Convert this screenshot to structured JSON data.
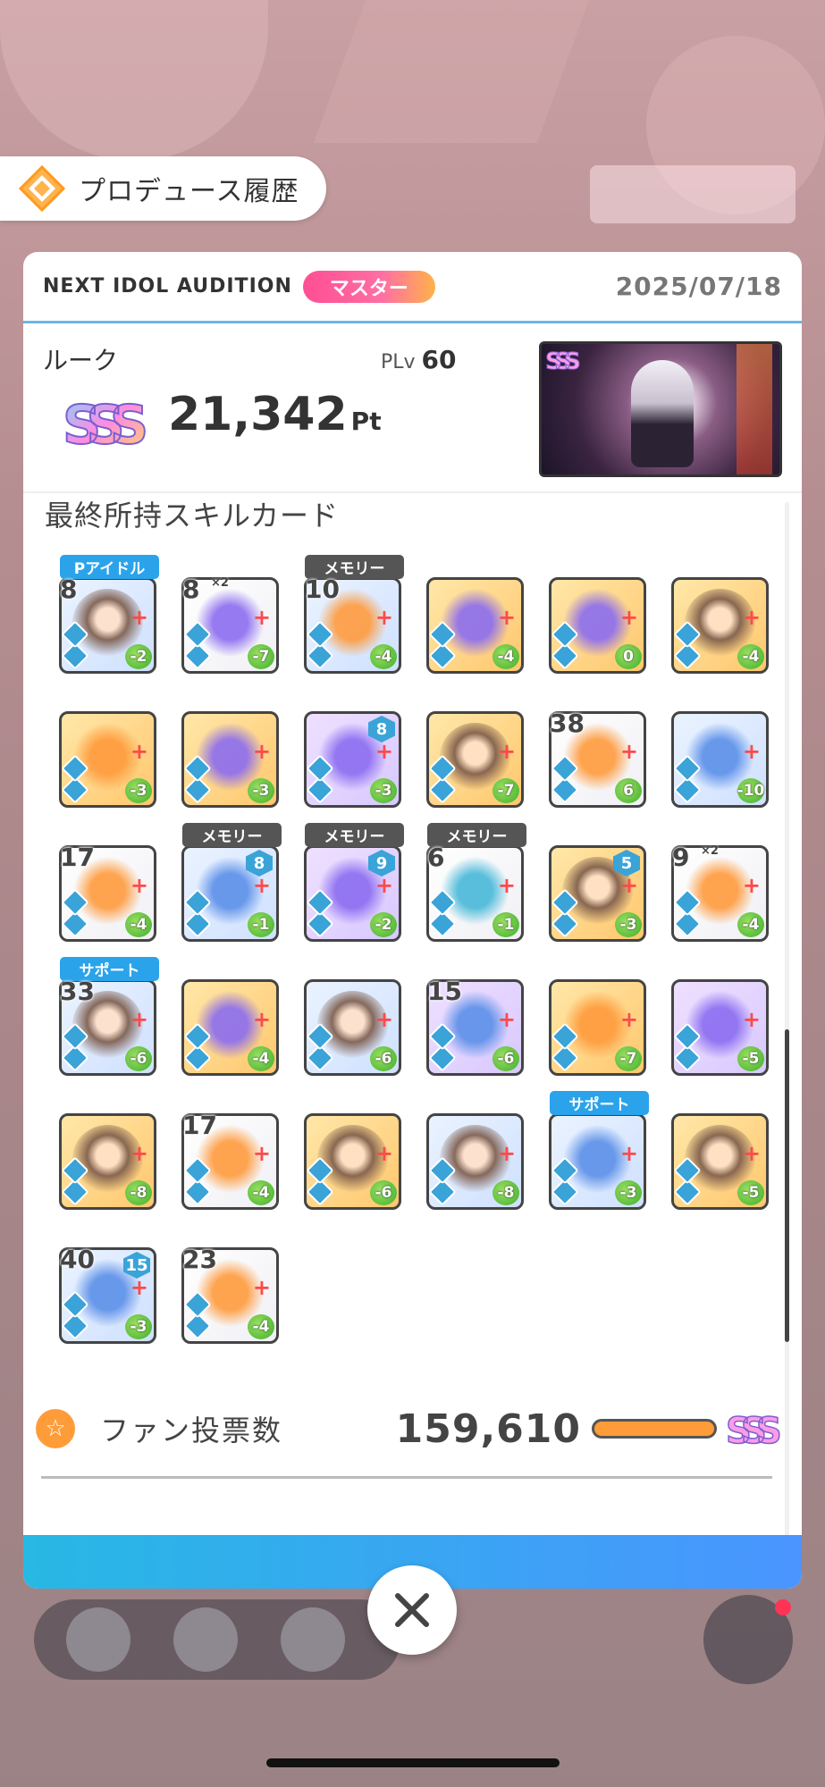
{
  "header": {
    "title": "プロデュース履歴"
  },
  "summary": {
    "audition": "NEXT IDOL AUDITION",
    "difficulty": "マスター",
    "date": "2025/07/18",
    "idol_name": "ルーク",
    "plv_label": "PLv",
    "plv_value": "60",
    "rank": "SSS",
    "score": "21,342",
    "score_unit": "Pt"
  },
  "skill_cards_title": "最終所持スキルカード",
  "cards": [
    [
      {
        "lv": "8",
        "cost": "-2",
        "tag": "Pアイドル",
        "tag_color": "blue",
        "art": "face",
        "bg": "c-blue"
      },
      {
        "lv": "8",
        "count": "×2",
        "cost": "-7",
        "art": "purple",
        "bg": "c-white"
      },
      {
        "lv": "10",
        "cost": "-4",
        "tag": "メモリー",
        "art": "orange",
        "bg": "c-blue"
      },
      {
        "lv": "",
        "cost": "-4",
        "art": "purple",
        "bg": "c-gold"
      },
      {
        "lv": "",
        "cost": "0",
        "art": "purple",
        "bg": "c-gold"
      },
      {
        "lv": "",
        "cost": "-4",
        "art": "face",
        "bg": "c-gold"
      }
    ],
    [
      {
        "lv": "",
        "cost": "-3",
        "art": "orange",
        "bg": "c-gold"
      },
      {
        "lv": "",
        "cost": "-3",
        "art": "purple",
        "bg": "c-gold"
      },
      {
        "lv": "",
        "top": "8",
        "cost": "-3",
        "art": "purple",
        "bg": "c-purple"
      },
      {
        "lv": "",
        "cost": "-7",
        "art": "face",
        "bg": "c-gold"
      },
      {
        "lv": "38",
        "cost": "6",
        "art": "orange",
        "bg": "c-white"
      },
      {
        "lv": "",
        "cost": "-10",
        "art": "blue",
        "bg": "c-blue"
      }
    ],
    [
      {
        "lv": "17",
        "cost": "-4",
        "art": "orange",
        "bg": "c-white"
      },
      {
        "lv": "",
        "top": "8",
        "cost": "-1",
        "tag": "メモリー",
        "art": "blue",
        "bg": "c-blue"
      },
      {
        "lv": "",
        "top": "9",
        "cost": "-2",
        "tag": "メモリー",
        "art": "purple",
        "bg": "c-purple"
      },
      {
        "lv": "6",
        "cost": "-1",
        "tag": "メモリー",
        "art": "teal",
        "bg": "c-white"
      },
      {
        "lv": "",
        "top": "5",
        "cost": "-3",
        "art": "face",
        "bg": "c-gold"
      },
      {
        "lv": "9",
        "count": "×2",
        "cost": "-4",
        "art": "orange",
        "bg": "c-white"
      }
    ],
    [
      {
        "lv": "33",
        "cost": "-6",
        "tag": "サポート",
        "tag_color": "blue",
        "art": "face",
        "bg": "c-blue"
      },
      {
        "lv": "",
        "cost": "-4",
        "art": "purple",
        "bg": "c-gold"
      },
      {
        "lv": "",
        "cost": "-6",
        "art": "face",
        "bg": "c-blue"
      },
      {
        "lv": "15",
        "cost": "-6",
        "art": "blue",
        "bg": "c-purple"
      },
      {
        "lv": "",
        "cost": "-7",
        "art": "orange",
        "bg": "c-gold"
      },
      {
        "lv": "",
        "cost": "-5",
        "art": "purple",
        "bg": "c-purple"
      }
    ],
    [
      {
        "lv": "",
        "cost": "-8",
        "art": "face",
        "bg": "c-gold"
      },
      {
        "lv": "17",
        "cost": "-4",
        "art": "orange",
        "bg": "c-white"
      },
      {
        "lv": "",
        "cost": "-6",
        "art": "face",
        "bg": "c-gold"
      },
      {
        "lv": "",
        "cost": "-8",
        "art": "face",
        "bg": "c-blue"
      },
      {
        "lv": "",
        "cost": "-3",
        "tag": "サポート",
        "tag_color": "blue",
        "art": "blue",
        "bg": "c-blue"
      },
      {
        "lv": "",
        "cost": "-5",
        "art": "face",
        "bg": "c-gold"
      }
    ],
    [
      {
        "lv": "40",
        "top": "15",
        "cost": "-3",
        "art": "blue",
        "bg": "c-blue"
      },
      {
        "lv": "23",
        "cost": "-4",
        "art": "orange",
        "bg": "c-white"
      }
    ]
  ],
  "fan_votes": {
    "label": "ファン投票数",
    "value": "159,610",
    "rank": "SSS"
  },
  "icons": {
    "history": "history-icon",
    "close": "close-icon",
    "fan": "star-icon"
  },
  "colors": {
    "accent_blue": "#27b8e4",
    "master_pink": "#ff4e93",
    "fan_orange": "#ff9c3a"
  }
}
